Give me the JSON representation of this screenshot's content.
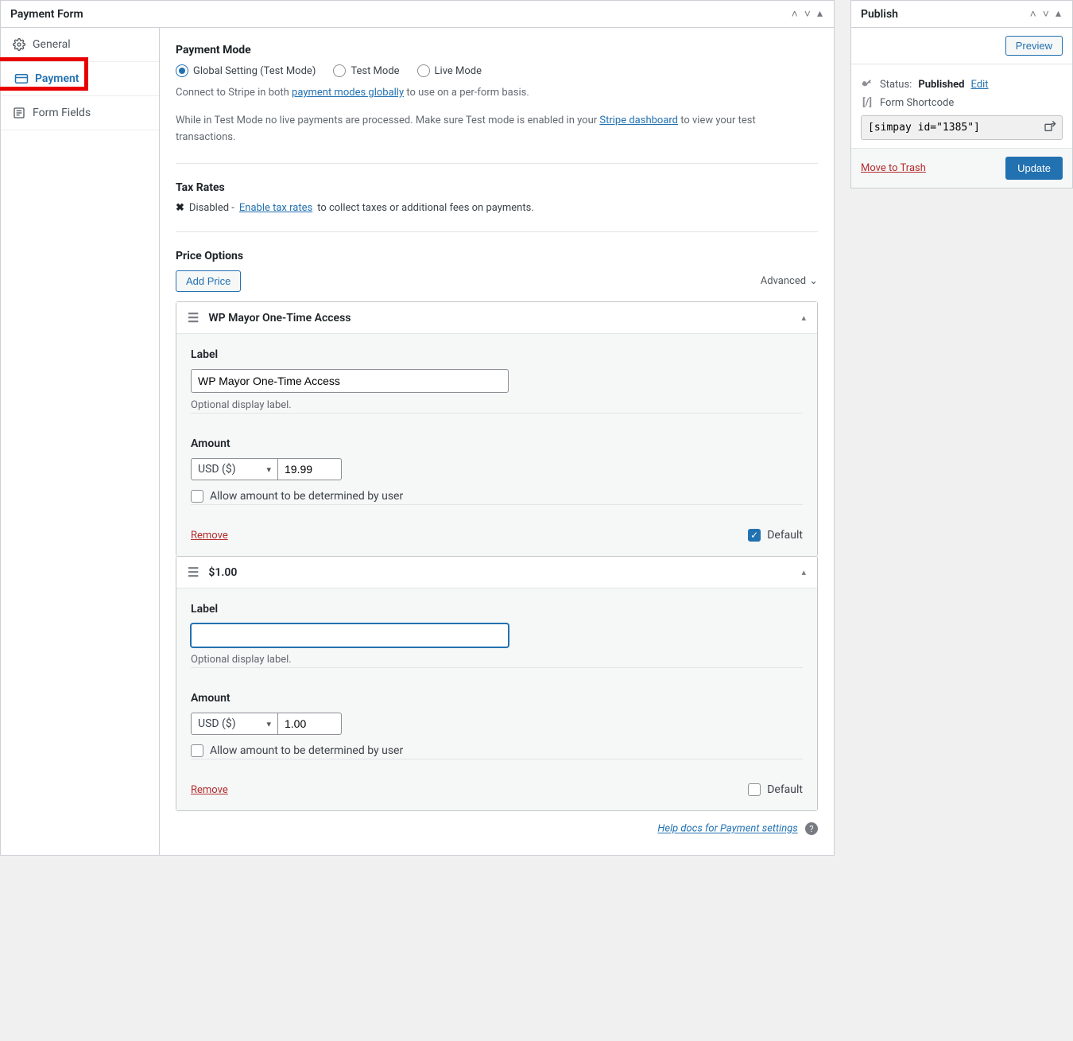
{
  "main_panel": {
    "title": "Payment Form",
    "tabs": {
      "general": "General",
      "payment": "Payment",
      "form_fields": "Form Fields"
    },
    "payment_mode": {
      "heading": "Payment Mode",
      "options": {
        "global": "Global Setting (Test Mode)",
        "test": "Test Mode",
        "live": "Live Mode"
      },
      "desc_pre": "Connect to Stripe in both ",
      "desc_link": "payment modes globally",
      "desc_post": " to use on a per-form basis.",
      "testnote_pre": "While in Test Mode no live payments are processed. Make sure Test mode is enabled in your ",
      "testnote_link": "Stripe dashboard",
      "testnote_post": " to view your test transactions."
    },
    "tax": {
      "heading": "Tax Rates",
      "status": "Disabled - ",
      "link": "Enable tax rates",
      "rest": " to collect taxes or additional fees on payments."
    },
    "price": {
      "heading": "Price Options",
      "add_btn": "Add Price",
      "advanced": "Advanced",
      "items": [
        {
          "title": "WP Mayor One-Time Access",
          "label_heading": "Label",
          "label_value": "WP Mayor One-Time Access",
          "label_hint": "Optional display label.",
          "amount_heading": "Amount",
          "currency": "USD ($)",
          "amount": "19.99",
          "allow_user": "Allow amount to be determined by user",
          "remove": "Remove",
          "default_label": "Default",
          "default_checked": true,
          "focused": false
        },
        {
          "title": "$1.00",
          "label_heading": "Label",
          "label_value": "",
          "label_hint": "Optional display label.",
          "amount_heading": "Amount",
          "currency": "USD ($)",
          "amount": "1.00",
          "allow_user": "Allow amount to be determined by user",
          "remove": "Remove",
          "default_label": "Default",
          "default_checked": false,
          "focused": true
        }
      ]
    },
    "helpdocs": "Help docs for Payment settings"
  },
  "publish": {
    "title": "Publish",
    "preview": "Preview",
    "status_label": "Status: ",
    "status_value": "Published",
    "edit": "Edit",
    "shortcode_label": "Form Shortcode",
    "shortcode_value": "[simpay id=\"1385\"]",
    "trash": "Move to Trash",
    "update": "Update"
  }
}
